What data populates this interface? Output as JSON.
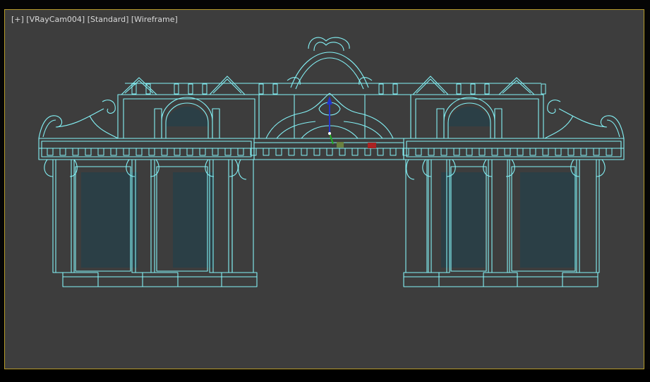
{
  "viewport": {
    "menus": {
      "plus": "+",
      "camera": "VRayCam004",
      "shading": "Standard",
      "mode": "Wireframe"
    }
  },
  "colors": {
    "viewport_bg": "#3d3d3d",
    "active_border": "#b59a2a",
    "wire": "#84f2f6",
    "wire_dark": "#3fa9b8",
    "panel_fill": "#2b3f46",
    "gizmo_z": "#2233cc",
    "gizmo_x": "#cc2222",
    "gizmo_y": "#22aa22"
  },
  "scene": {
    "object": "archway-gate-model",
    "gizmo": "transform-gizmo"
  }
}
